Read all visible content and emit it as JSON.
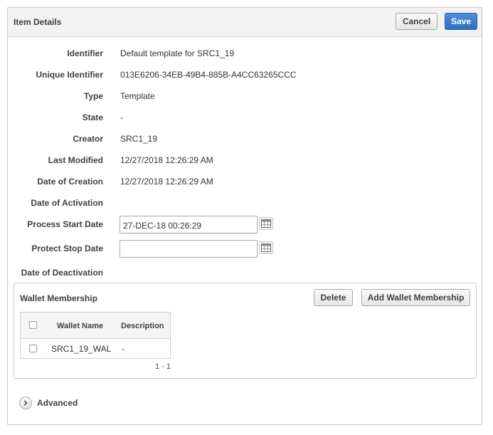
{
  "dialog": {
    "title": "Item Details",
    "cancel_label": "Cancel",
    "save_label": "Save"
  },
  "fields": {
    "identifier": {
      "label": "Identifier",
      "value": "Default template for SRC1_19"
    },
    "unique_identifier": {
      "label": "Unique Identifier",
      "value": "013E6206-34EB-49B4-885B-A4CC63265CCC"
    },
    "type": {
      "label": "Type",
      "value": "Template"
    },
    "state": {
      "label": "State",
      "value": "-"
    },
    "creator": {
      "label": "Creator",
      "value": "SRC1_19"
    },
    "last_modified": {
      "label": "Last Modified",
      "value": "12/27/2018 12:26:29 AM"
    },
    "date_of_creation": {
      "label": "Date of Creation",
      "value": "12/27/2018 12:26:29 AM"
    },
    "date_of_activation": {
      "label": "Date of Activation",
      "value": ""
    },
    "process_start_date": {
      "label": "Process Start Date",
      "value": "27-DEC-18 00:26:29"
    },
    "protect_stop_date": {
      "label": "Protect Stop Date",
      "value": ""
    },
    "date_of_deactivation": {
      "label": "Date of Deactivation",
      "value": ""
    }
  },
  "wallet_membership": {
    "title": "Wallet Membership",
    "delete_label": "Delete",
    "add_label": "Add Wallet Membership",
    "columns": [
      "Wallet Name",
      "Description"
    ],
    "rows": [
      {
        "wallet_name": "SRC1_19_WAL",
        "description": "-"
      }
    ],
    "pagination": "1 - 1"
  },
  "advanced": {
    "label": "Advanced"
  },
  "colors": {
    "primary_button": "#2f6fc0",
    "header_bg": "#f2f2f2",
    "border": "#c8c8c8"
  },
  "icons": {
    "calendar": "calendar-icon",
    "expand": "chevron-right-icon"
  }
}
